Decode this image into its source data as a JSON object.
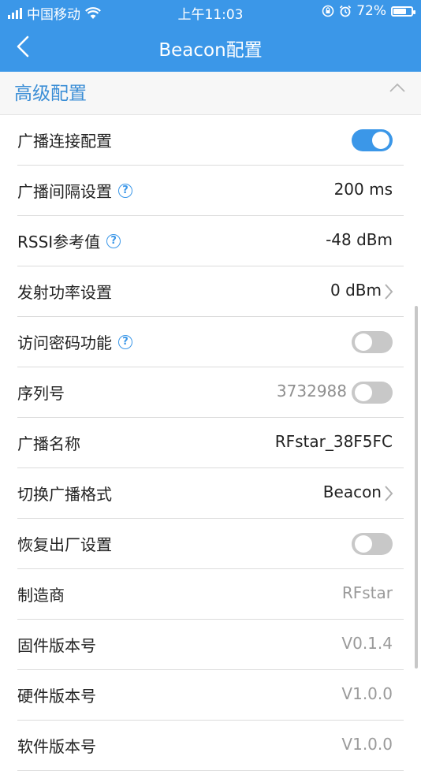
{
  "status": {
    "carrier": "中国移动",
    "time": "上午11:03",
    "battery": "72%",
    "battery_level": 0.72
  },
  "nav": {
    "title": "Beacon配置"
  },
  "section": {
    "title": "高级配置"
  },
  "rows": [
    {
      "label": "广播连接配置",
      "toggle": "on"
    },
    {
      "label": "广播间隔设置",
      "value": "200 ms"
    },
    {
      "label": "RSSI参考值",
      "value": "-48 dBm"
    },
    {
      "label": "发射功率设置",
      "value": "0 dBm"
    },
    {
      "label": "访问密码功能",
      "toggle": "off"
    },
    {
      "label": "序列号",
      "value": "3732988",
      "toggle": "off"
    },
    {
      "label": "广播名称",
      "value": "RFstar_38F5FC"
    },
    {
      "label": "切换广播格式",
      "value": "Beacon"
    },
    {
      "label": "恢复出厂设置",
      "toggle": "off"
    },
    {
      "label": "制造商",
      "value": "RFstar"
    },
    {
      "label": "固件版本号",
      "value": "V0.1.4"
    },
    {
      "label": "硬件版本号",
      "value": "V1.0.0"
    },
    {
      "label": "软件版本号",
      "value": "V1.0.0"
    }
  ],
  "icons": {
    "help": "?",
    "back": "chevron-left-icon",
    "collapse": "chevron-up-icon",
    "chevron": "chevron-right-icon"
  },
  "colors": {
    "accent": "#3b97e8",
    "section_title": "#3b8ed6"
  }
}
